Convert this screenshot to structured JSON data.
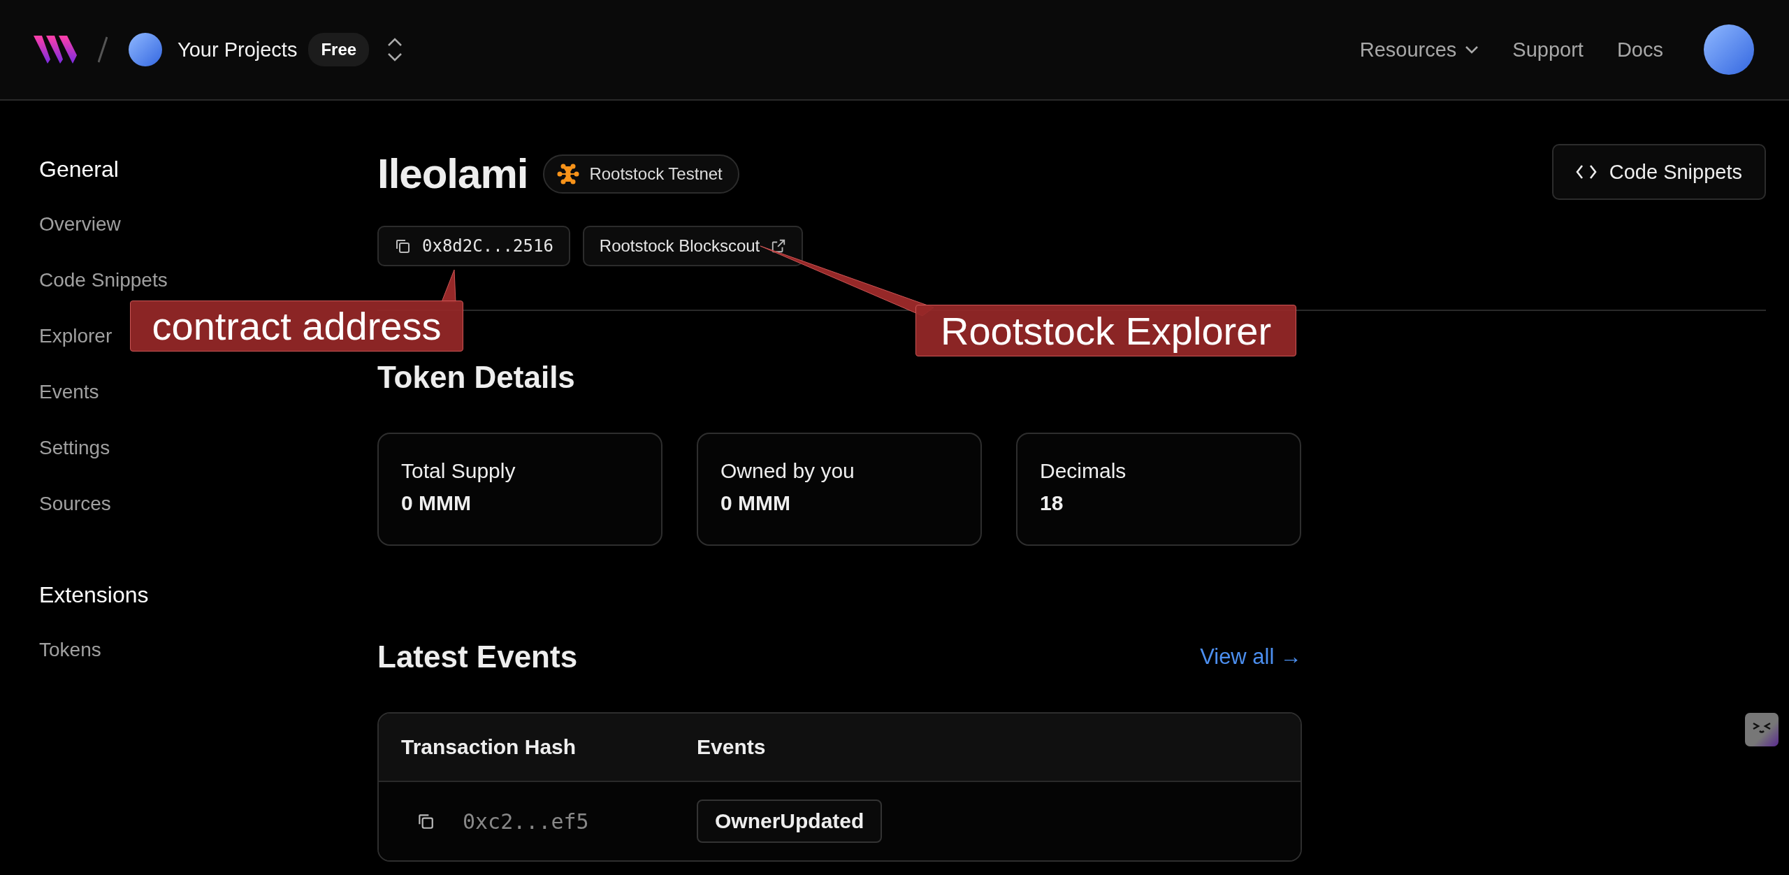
{
  "header": {
    "project": "Your Projects",
    "plan": "Free",
    "nav": [
      {
        "label": "Resources",
        "kind": "menu"
      },
      {
        "label": "Support",
        "kind": "link"
      },
      {
        "label": "Docs",
        "kind": "link"
      }
    ]
  },
  "sidebar": {
    "sections": [
      {
        "title": "General",
        "items": [
          "Overview",
          "Code Snippets",
          "Explorer",
          "Events",
          "Settings",
          "Sources"
        ]
      },
      {
        "title": "Extensions",
        "items": [
          "Tokens"
        ]
      }
    ]
  },
  "contract": {
    "name": "Ileolami",
    "network": "Rootstock Testnet",
    "address": "0x8d2C...2516",
    "explorer": "Rootstock Blockscout",
    "action": "Code Snippets"
  },
  "token_details": {
    "title": "Token Details",
    "cards": [
      {
        "label": "Total Supply",
        "value": "0 MMM"
      },
      {
        "label": "Owned by you",
        "value": "0 MMM"
      },
      {
        "label": "Decimals",
        "value": "18"
      }
    ]
  },
  "latest_events": {
    "title": "Latest Events",
    "link": "View all →",
    "columns": [
      "Transaction Hash",
      "Events"
    ],
    "rows": [
      {
        "hash": "0xc2...ef5",
        "event": "OwnerUpdated"
      }
    ]
  },
  "annotations": [
    {
      "text": "contract address"
    },
    {
      "text": "Rootstock Explorer"
    }
  ]
}
